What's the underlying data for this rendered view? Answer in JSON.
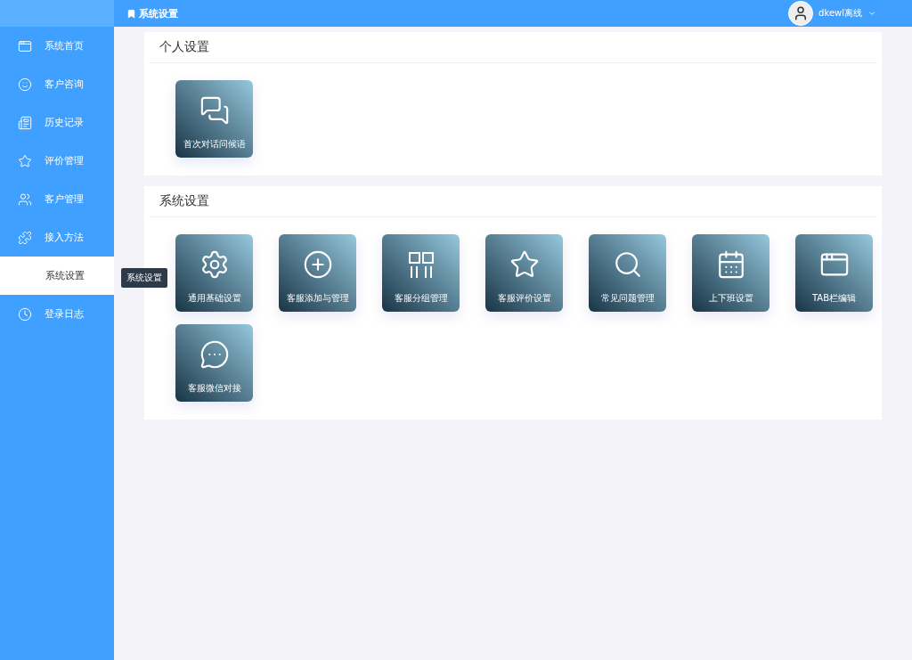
{
  "topbar": {
    "title": "系统设置",
    "user": "dkewl离线"
  },
  "sidebar": {
    "items": [
      {
        "label": "系统首页",
        "selected": false
      },
      {
        "label": "客户咨询",
        "selected": false
      },
      {
        "label": "历史记录",
        "selected": false
      },
      {
        "label": "评价管理",
        "selected": false
      },
      {
        "label": "客户管理",
        "selected": false
      },
      {
        "label": "接入方法",
        "selected": false
      },
      {
        "label": "系统设置",
        "selected": true
      },
      {
        "label": "登录日志",
        "selected": false
      }
    ],
    "tooltip": "系统设置"
  },
  "sections": [
    {
      "title": "个人设置",
      "tiles": [
        "首次对话问候语"
      ]
    },
    {
      "title": "系统设置",
      "tiles": [
        "通用基础设置",
        "客服添加与管理",
        "客服分组管理",
        "客服评价设置",
        "常见问题管理",
        "上下班设置",
        "TAB栏编辑",
        "客服微信对接"
      ]
    }
  ]
}
